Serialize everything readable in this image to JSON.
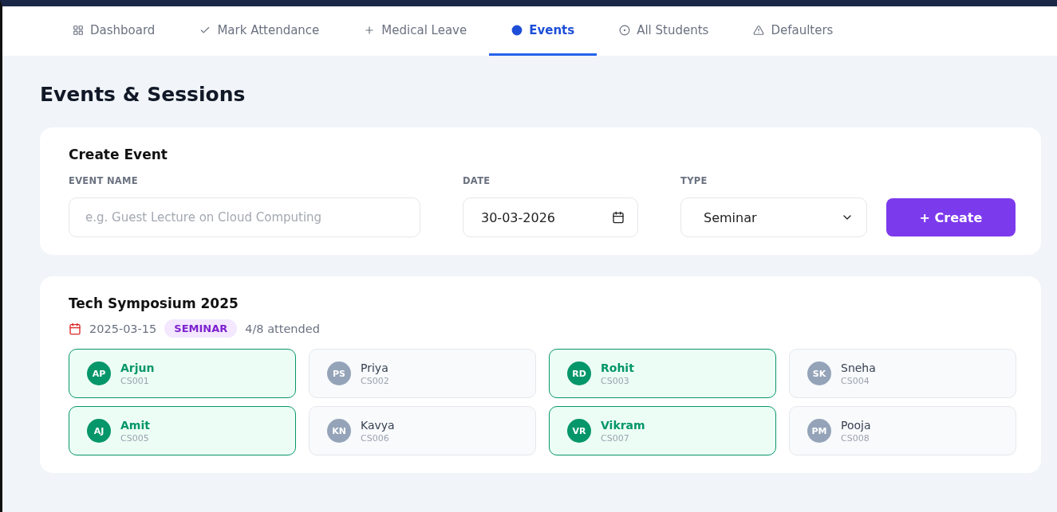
{
  "nav": {
    "tabs": [
      {
        "label": "Dashboard",
        "selected": false
      },
      {
        "label": "Mark Attendance",
        "selected": false
      },
      {
        "label": "Medical Leave",
        "selected": false
      },
      {
        "label": "Events",
        "selected": true
      },
      {
        "label": "All Students",
        "selected": false
      },
      {
        "label": "Defaulters",
        "selected": false
      }
    ]
  },
  "page_title": "Events & Sessions",
  "create_event": {
    "title": "Create Event",
    "fields": [
      {
        "kind": "text",
        "label": "EVENT NAME",
        "placeholder": "e.g. Guest Lecture on Cloud Computing"
      },
      {
        "kind": "date",
        "label": "DATE",
        "value": "30-03-2026"
      },
      {
        "kind": "select",
        "label": "TYPE",
        "value": "Seminar"
      }
    ],
    "button": "+ Create"
  },
  "events": [
    {
      "title": "Tech Symposium 2025",
      "date": "2025-03-15",
      "type": "SEMINAR",
      "attendance": "4/8 attended",
      "attendees": [
        {
          "initials": "AP",
          "name": "Arjun",
          "id": "CS001",
          "present": true
        },
        {
          "initials": "PS",
          "name": "Priya",
          "id": "CS002",
          "present": false
        },
        {
          "initials": "RD",
          "name": "Rohit",
          "id": "CS003",
          "present": true
        },
        {
          "initials": "SK",
          "name": "Sneha",
          "id": "CS004",
          "present": false
        },
        {
          "initials": "AJ",
          "name": "Amit",
          "id": "CS005",
          "present": true
        },
        {
          "initials": "KN",
          "name": "Kavya",
          "id": "CS006",
          "present": false
        },
        {
          "initials": "VR",
          "name": "Vikram",
          "id": "CS007",
          "present": true
        },
        {
          "initials": "PM",
          "name": "Pooja",
          "id": "CS008",
          "present": false
        }
      ]
    }
  ]
}
